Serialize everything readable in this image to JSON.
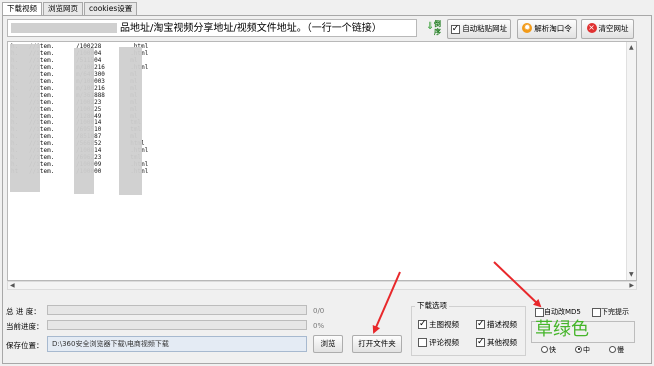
{
  "tabs": [
    {
      "label": "下载视频",
      "active": true
    },
    {
      "label": "浏览网页",
      "active": false
    },
    {
      "label": "cookies设置",
      "active": false
    }
  ],
  "url_input": {
    "hint_visible_part": "品地址/淘宝视频分享地址/视频文件地址。（一行一个链接）"
  },
  "toolbar": {
    "sort_label": "倒序",
    "auto_paste_label": "自动粘贴网址",
    "auto_paste_checked": true,
    "parse_button": "解析淘口令",
    "clear_button": "清空网址"
  },
  "url_list": {
    "lines": [
      "h.   //item.      /100228        .html",
      "h.   //item.      /100004        .html",
      "h.   //item.      /511504        ml",
      "h.   //item.      m/100216       .html",
      "h.   //item.      m/649300       ml",
      "h.   //item.      m/100003       ml",
      "h.   //item.      m/100216       ml",
      "h.   //item.      m/361888       ml",
      "h.   //item.      /100223        ml",
      "h.   //item.      /100225        ml",
      "h.   //item.      /128049        ml",
      "h.   //item.      /100014        tml",
      "h.   //item.      /695510        tml",
      "h.   //item.      /851087        ml",
      "h.   //item.      /566852        html",
      "h.   //item.      /100014        .html",
      "h.   //item.      /696223        tml",
      "h.   //item.      /100009        .html",
      "ht   //item.      /100000        .html"
    ]
  },
  "progress": {
    "total_label": "总 进 度：",
    "total_value": "0/0",
    "total_fraction": 0,
    "current_label": "当前进度：",
    "current_value": "0%",
    "current_fraction": 0
  },
  "save": {
    "label": "保存位置：",
    "path": "D:\\360安全浏览器下载\\电商视频下载",
    "browse_button": "浏览",
    "open_folder_button": "打开文件夹"
  },
  "download_options": {
    "title": "下载选项",
    "items": [
      {
        "label": "主图视频",
        "checked": true
      },
      {
        "label": "描述视频",
        "checked": true
      },
      {
        "label": "评论视频",
        "checked": false
      },
      {
        "label": "其他视频",
        "checked": true
      }
    ]
  },
  "settings": {
    "auto_md5_label": "自动改MD5",
    "auto_md5_checked": false,
    "finish_tip_label": "下完提示",
    "finish_tip_checked": false,
    "color_name": "草绿色",
    "color_hex": "#45b52a",
    "speed_options": [
      {
        "label": "快",
        "selected": false
      },
      {
        "label": "中",
        "selected": true
      },
      {
        "label": "慢",
        "selected": false
      }
    ]
  },
  "colors": {
    "annotation_arrow": "#e8282b",
    "accent_green": "#45b52a"
  }
}
